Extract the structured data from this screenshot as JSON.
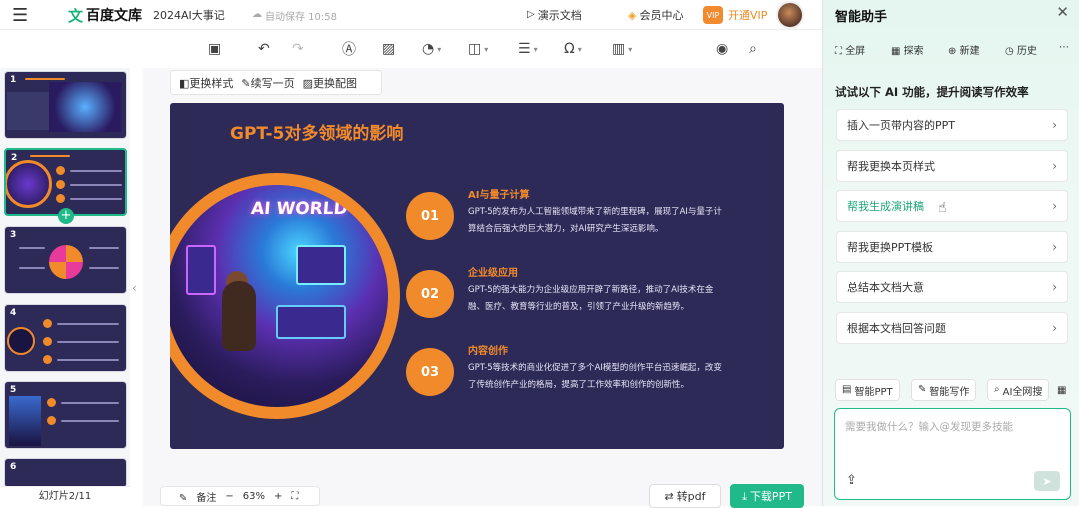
{
  "topbar": {
    "menu_icon": "hamburger-icon",
    "logo_mark": "文",
    "logo_text": "百度文库",
    "doc_title": "2024AI大事记",
    "saved_status": "自动保存 10:58",
    "present_label": "演示文档",
    "member_label": "会员中心",
    "vip_badge": "VIP",
    "open_vip_label": "开通VIP"
  },
  "toolbar": {
    "tools": [
      "save-icon",
      "undo-icon",
      "redo-icon",
      "text-icon",
      "image-icon",
      "shape-icon",
      "media-icon",
      "align-icon",
      "symbol-icon",
      "chart-icon",
      "preview-icon",
      "search-icon"
    ]
  },
  "thumbs": {
    "numbers": [
      "1",
      "2",
      "3",
      "4",
      "5",
      "6"
    ],
    "selected": 2,
    "slide_counter": "幻灯片2/11"
  },
  "slide_tools": {
    "change_style": "更换样式",
    "continue_page": "续写一页",
    "change_image": "更换配图"
  },
  "slide": {
    "title": "GPT-5对多领域的影响",
    "art_text": "AI WORLD",
    "items": [
      {
        "num": "01",
        "title": "AI与量子计算",
        "desc": "GPT-5的发布为人工智能领域带来了新的里程碑，展现了AI与量子计算结合后强大的巨大潜力，对AI研究产生深远影响。"
      },
      {
        "num": "02",
        "title": "企业级应用",
        "desc": "GPT-5的强大能力为企业级应用开辟了新路径，推动了AI技术在金融、医疗、教育等行业的普及，引领了产业升级的新趋势。"
      },
      {
        "num": "03",
        "title": "内容创作",
        "desc": "GPT-5等技术的商业化促进了多个AI模型的创作平台迅速崛起，改变了传统创作产业的格局，提高了工作效率和创作的创新性。"
      }
    ]
  },
  "bottombar": {
    "notes_label": "备注",
    "zoom": "63%",
    "to_pdf_label": "转pdf",
    "download_label": "下载PPT"
  },
  "panel": {
    "title": "智能助手",
    "tabs": [
      "全屏",
      "探索",
      "新建",
      "历史"
    ],
    "hint": "试试以下 AI 功能，提升阅读写作效率",
    "suggestions": [
      "插入一页带内容的PPT",
      "帮我更换本页样式",
      "帮我生成演讲稿",
      "帮我更换PPT模板",
      "总结本文档大意",
      "根据本文档回答问题"
    ],
    "highlighted": 2,
    "quick": [
      "智能PPT",
      "智能写作",
      "AI全网搜"
    ],
    "input_placeholder": "需要我做什么？输入@发现更多技能"
  },
  "colors": {
    "accent": "#1fb98a",
    "slide_bg": "#2e2a58",
    "orange": "#f08a2a"
  }
}
